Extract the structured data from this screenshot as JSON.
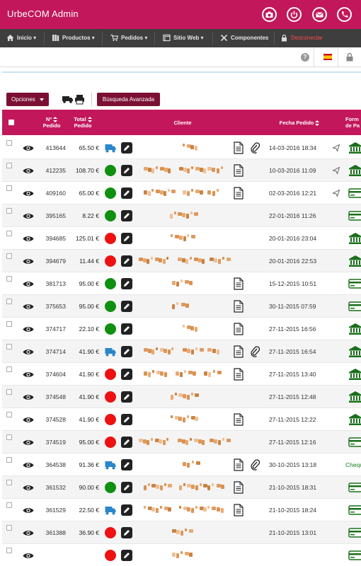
{
  "app": {
    "title": "UrbeCOM Admin"
  },
  "topbar_icons": [
    "camera-icon",
    "power-icon",
    "mail-icon",
    "phone-icon"
  ],
  "colors": {
    "brand": "#c2185b",
    "dark_button": "#7b1034",
    "nav_bg": "#3e3e3e",
    "status_green": "#109010",
    "status_red": "#ee1111",
    "status_blue": "#2a86c9",
    "pay_green": "#1b6e1b"
  },
  "nav": {
    "items": [
      {
        "label": "Inicio ▾",
        "icon": "home-icon"
      },
      {
        "label": "Productos ▾",
        "icon": "books-icon"
      },
      {
        "label": "Pedidos ▾",
        "icon": "cart-icon"
      },
      {
        "label": "Sitio Web ▾",
        "icon": "window-icon"
      },
      {
        "label": "Componentes",
        "icon": "tools-icon"
      },
      {
        "label": "Desconectar",
        "icon": "lock-icon"
      }
    ]
  },
  "subbar": {
    "help": "?",
    "language": "spanish-flag-icon",
    "lock": "lock-icon"
  },
  "toolbar": {
    "options_label": "Opciones",
    "advanced_search_label": "Búsqueda Avanzada"
  },
  "table": {
    "headers": {
      "num_line1": "Nº",
      "num_line2": "Pedido",
      "total_line1": "Total",
      "total_line2": "Pedido",
      "cliente": "Cliente",
      "fecha": "Fecha Pedido",
      "forma_line1": "Form",
      "forma_line2": "de Pa"
    },
    "rows": [
      {
        "num": "413644",
        "total": "65.50 €",
        "status": "truck",
        "doc": true,
        "clip": true,
        "fecha": "14-03-2016 18:34",
        "plane": true,
        "pay": "bank"
      },
      {
        "num": "412235",
        "total": "108.70 €",
        "status": "green",
        "doc": true,
        "clip": false,
        "fecha": "10-03-2016 11:09",
        "plane": true,
        "pay": "bank"
      },
      {
        "num": "409160",
        "total": "65.00 €",
        "status": "green",
        "doc": true,
        "clip": false,
        "fecha": "02-03-2016 12:21",
        "plane": true,
        "pay": "card"
      },
      {
        "num": "395165",
        "total": "8.22 €",
        "status": "green",
        "doc": false,
        "clip": false,
        "fecha": "22-01-2016 11:26",
        "plane": false,
        "pay": "card"
      },
      {
        "num": "394685",
        "total": "125.01 €",
        "status": "red",
        "doc": false,
        "clip": false,
        "fecha": "20-01-2016 23:04",
        "plane": false,
        "pay": "bank"
      },
      {
        "num": "394679",
        "total": "11.44 €",
        "status": "red",
        "doc": false,
        "clip": false,
        "fecha": "20-01-2016 22:53",
        "plane": false,
        "pay": "bank"
      },
      {
        "num": "381713",
        "total": "95.00 €",
        "status": "green",
        "doc": true,
        "clip": false,
        "fecha": "15-12-2015 10:51",
        "plane": false,
        "pay": "card"
      },
      {
        "num": "375653",
        "total": "95.00 €",
        "status": "green",
        "doc": true,
        "clip": false,
        "fecha": "30-11-2015 07:59",
        "plane": false,
        "pay": "card"
      },
      {
        "num": "374717",
        "total": "22.10 €",
        "status": "green",
        "doc": true,
        "clip": false,
        "fecha": "27-11-2015 16:56",
        "plane": false,
        "pay": "bank"
      },
      {
        "num": "374714",
        "total": "41.90 €",
        "status": "truck",
        "doc": true,
        "clip": true,
        "fecha": "27-11-2015 16:54",
        "plane": false,
        "pay": "bank"
      },
      {
        "num": "374604",
        "total": "41.90 €",
        "status": "red",
        "doc": true,
        "clip": false,
        "fecha": "27-11-2015 13:40",
        "plane": false,
        "pay": "bank"
      },
      {
        "num": "374548",
        "total": "41.90 €",
        "status": "red",
        "doc": false,
        "clip": false,
        "fecha": "27-11-2015 12:48",
        "plane": false,
        "pay": "bank"
      },
      {
        "num": "374528",
        "total": "41.90 €",
        "status": "red",
        "doc": true,
        "clip": false,
        "fecha": "27-11-2015 12:22",
        "plane": false,
        "pay": "bank"
      },
      {
        "num": "374519",
        "total": "95.00 €",
        "status": "red",
        "doc": false,
        "clip": false,
        "fecha": "27-11-2015 12:16",
        "plane": false,
        "pay": "card"
      },
      {
        "num": "364538",
        "total": "91.36 €",
        "status": "truck",
        "doc": true,
        "clip": true,
        "fecha": "30-10-2015 13:18",
        "plane": false,
        "pay": "text",
        "pay_text": "Chequ"
      },
      {
        "num": "361532",
        "total": "90.00 €",
        "status": "green",
        "doc": true,
        "clip": false,
        "fecha": "21-10-2015 18:31",
        "plane": false,
        "pay": "card"
      },
      {
        "num": "361529",
        "total": "22.50 €",
        "status": "truck",
        "doc": true,
        "clip": false,
        "fecha": "21-10-2015 18:24",
        "plane": false,
        "pay": "card"
      },
      {
        "num": "361388",
        "total": "36.90 €",
        "status": "red",
        "doc": false,
        "clip": false,
        "fecha": "21-10-2015 13:01",
        "plane": false,
        "pay": "card"
      },
      {
        "num": "",
        "total": "",
        "status": "red",
        "doc": false,
        "clip": false,
        "fecha": "",
        "plane": false,
        "pay": "card"
      }
    ]
  }
}
